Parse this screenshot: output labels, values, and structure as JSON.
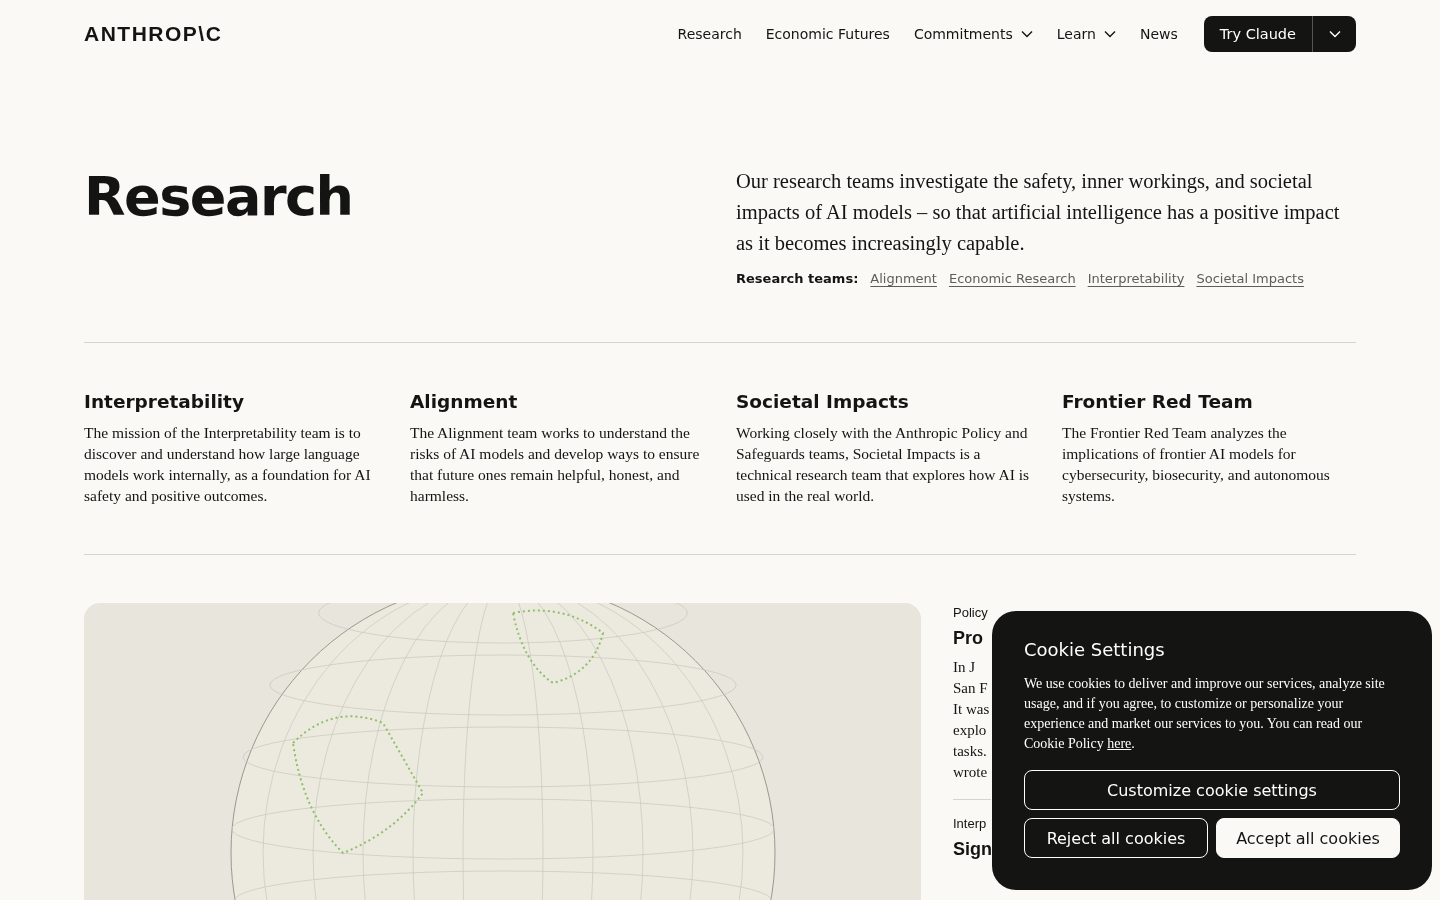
{
  "header": {
    "logo": "ANTHROP\\C",
    "nav": [
      {
        "label": "Research",
        "kind": "link"
      },
      {
        "label": "Economic Futures",
        "kind": "link"
      },
      {
        "label": "Commitments",
        "kind": "dropdown"
      },
      {
        "label": "Learn",
        "kind": "dropdown"
      },
      {
        "label": "News",
        "kind": "link"
      }
    ],
    "cta": "Try Claude"
  },
  "hero": {
    "title": "Research",
    "intro": "Our research teams investigate the safety, inner workings, and societal impacts of AI models – so that artificial intelligence has a positive impact as it becomes increasingly capable.",
    "teams_label": "Research teams:",
    "teams": [
      "Alignment",
      "Economic Research",
      "Interpretability",
      "Societal Impacts"
    ]
  },
  "teams": [
    {
      "title": "Interpretability",
      "text": "The mission of the Interpretability team is to discover and understand how large language models work internally, as a foundation for AI safety and positive outcomes."
    },
    {
      "title": "Alignment",
      "text": "The Alignment team works to understand the risks of AI models and develop ways to ensure that future ones remain helpful, honest, and harmless."
    },
    {
      "title": "Societal Impacts",
      "text": "Working closely with the Anthropic Policy and Safeguards teams, Societal Impacts is a technical research team that explores how AI is used in the real world."
    },
    {
      "title": "Frontier Red Team",
      "text": "The Frontier Red Team analyzes the implications of frontier AI models for cybersecurity, biosecurity, and autonomous systems."
    }
  ],
  "articles": [
    {
      "category": "Policy",
      "title": "Pro",
      "lines": [
        "In J",
        "San F",
        "It was",
        "explo",
        "tasks.",
        "wrote"
      ]
    },
    {
      "category": "Interp",
      "title": "Sign"
    }
  ],
  "cookie_dialog": {
    "title": "Cookie Settings",
    "text": "We use cookies to deliver and improve our services, analyze site usage, and if you agree, to customize or personalize your experience and market our services to you. You can read our Cookie Policy",
    "link": "here",
    "text_end": ".",
    "buttons": [
      {
        "label": "Customize cookie settings",
        "kind": "outline"
      },
      {
        "label": "Reject all cookies",
        "kind": "outline"
      },
      {
        "label": "Accept all cookies",
        "kind": "filled"
      }
    ]
  }
}
